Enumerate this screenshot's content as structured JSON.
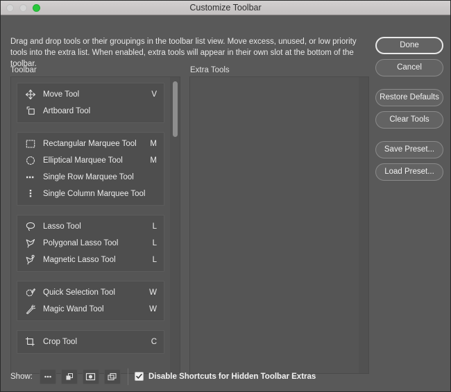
{
  "window": {
    "title": "Customize Toolbar",
    "traffic_lights": [
      "close-gray",
      "minimize-gray",
      "zoom-green"
    ]
  },
  "description": "Drag and drop tools or their groupings in the toolbar list view. Move excess, unused, or low priority tools into the extra list. When enabled, extra tools will appear in their own slot at the bottom of the toolbar.",
  "columns": {
    "toolbar_label": "Toolbar",
    "extra_label": "Extra Tools"
  },
  "toolbar_groups": [
    {
      "tools": [
        {
          "icon": "move-tool-icon",
          "name": "Move Tool",
          "key": "V"
        },
        {
          "icon": "artboard-tool-icon",
          "name": "Artboard Tool",
          "key": ""
        }
      ]
    },
    {
      "tools": [
        {
          "icon": "rectangular-marquee-tool-icon",
          "name": "Rectangular Marquee Tool",
          "key": "M"
        },
        {
          "icon": "elliptical-marquee-tool-icon",
          "name": "Elliptical Marquee Tool",
          "key": "M"
        },
        {
          "icon": "single-row-marquee-tool-icon",
          "name": "Single Row Marquee Tool",
          "key": ""
        },
        {
          "icon": "single-column-marquee-tool-icon",
          "name": "Single Column Marquee Tool",
          "key": ""
        }
      ]
    },
    {
      "tools": [
        {
          "icon": "lasso-tool-icon",
          "name": "Lasso Tool",
          "key": "L"
        },
        {
          "icon": "polygonal-lasso-tool-icon",
          "name": "Polygonal Lasso Tool",
          "key": "L"
        },
        {
          "icon": "magnetic-lasso-tool-icon",
          "name": "Magnetic Lasso Tool",
          "key": "L"
        }
      ]
    },
    {
      "tools": [
        {
          "icon": "quick-selection-tool-icon",
          "name": "Quick Selection Tool",
          "key": "W"
        },
        {
          "icon": "magic-wand-tool-icon",
          "name": "Magic Wand Tool",
          "key": "W"
        }
      ]
    },
    {
      "tools": [
        {
          "icon": "crop-tool-icon",
          "name": "Crop Tool",
          "key": "C"
        }
      ]
    }
  ],
  "extra_tools": [],
  "buttons": [
    {
      "label": "Done",
      "style": "default"
    },
    {
      "label": "Cancel",
      "style": "normal"
    },
    {
      "label": "Restore Defaults",
      "style": "normal"
    },
    {
      "label": "Clear Tools",
      "style": "normal"
    },
    {
      "label": "Save Preset...",
      "style": "normal"
    },
    {
      "label": "Load Preset...",
      "style": "normal"
    }
  ],
  "footer": {
    "show_label": "Show:",
    "icon_buttons": [
      "extra-tools-ellipsis-icon",
      "foreground-background-color-icon",
      "quick-mask-mode-icon",
      "screen-mode-icon"
    ],
    "checkbox_checked": true,
    "checkbox_label": "Disable Shortcuts for Hidden Toolbar Extras"
  },
  "colors": {
    "window_bg": "#595959",
    "panel_bg": "#555555",
    "group_bg": "#4e4e4e",
    "titlebar_bg": "#c9c6c6",
    "text": "#ebebeb",
    "zoom_light": "#28c83c"
  }
}
